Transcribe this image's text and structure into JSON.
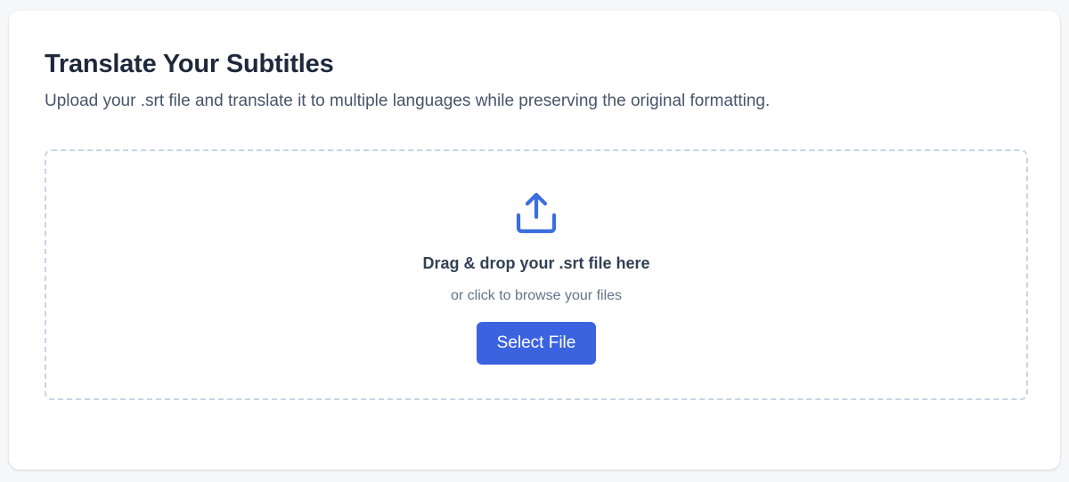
{
  "colors": {
    "page_background": "#f6f7f9",
    "card_background": "#ffffff",
    "title_text": "#1e293b",
    "subtitle_text": "#475569",
    "dropzone_border": "#c7d4e3",
    "accent": "#3b63e0",
    "icon": "#3b6fe0"
  },
  "header": {
    "title": "Translate Your Subtitles",
    "subtitle": "Upload your .srt file and translate it to multiple languages while preserving the original formatting."
  },
  "dropzone": {
    "icon": "upload-icon",
    "title": "Drag & drop your .srt file here",
    "hint": "or click to browse your files",
    "button_label": "Select File"
  }
}
